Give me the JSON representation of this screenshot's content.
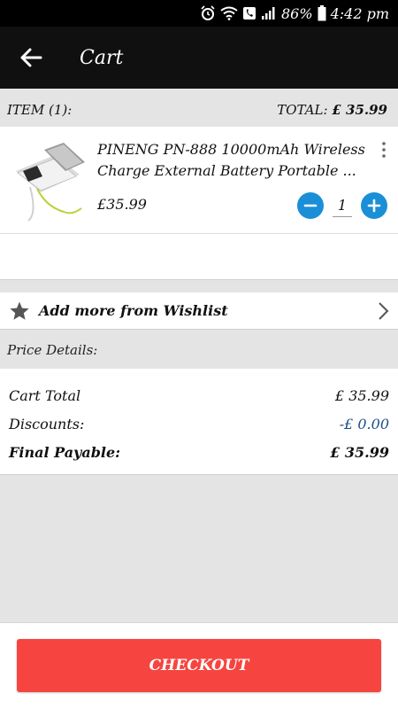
{
  "status_bar": {
    "battery_percent": "86%",
    "time": "4:42 pm"
  },
  "app_bar": {
    "title": "Cart",
    "back_icon": "arrow-left-icon"
  },
  "items_header": {
    "items_label": "ITEM (1):",
    "total_label": "TOTAL:",
    "total_value": "£ 35.99"
  },
  "cart_item": {
    "name_line1": "PINENG PN-888 10000mAh Wireless",
    "name_line2": "Charge External Battery Portable ...",
    "price": "£35.99",
    "quantity": "1"
  },
  "wishlist": {
    "label": "Add more from Wishlist"
  },
  "price_details": {
    "heading": "Price Details:",
    "rows": [
      {
        "label": "Cart Total",
        "value": "£ 35.99"
      },
      {
        "label": "Discounts:",
        "value": "-£ 0.00"
      },
      {
        "label": "Final Payable:",
        "value": "£ 35.99"
      }
    ]
  },
  "checkout": {
    "label": "CHECKOUT"
  },
  "colors": {
    "accent_blue": "#1a8fd8",
    "checkout_red": "#f64540",
    "discount_blue": "#1e4f8c"
  }
}
